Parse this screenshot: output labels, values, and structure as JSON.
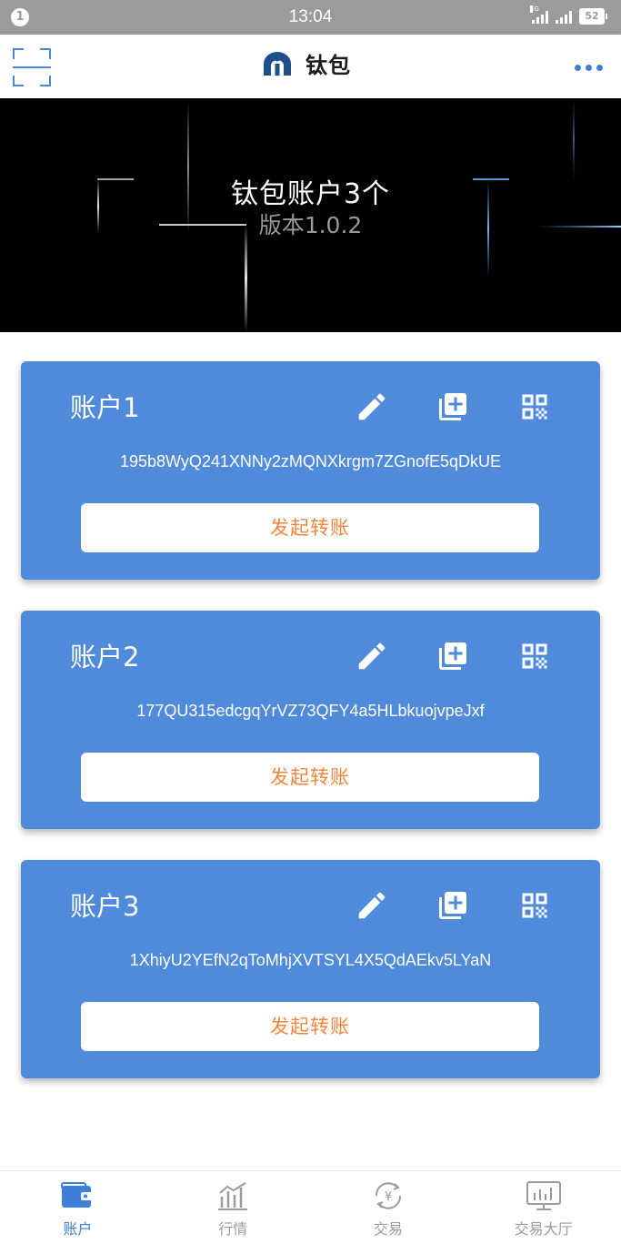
{
  "status_bar": {
    "notification_count": "1",
    "time": "13:04",
    "network_type": "4G",
    "battery": "52"
  },
  "app_bar": {
    "title": "钛包",
    "scan_icon": "scan-icon",
    "logo_icon": "titanium-wallet-logo",
    "more_icon": "more-dots-icon"
  },
  "banner": {
    "title": "钛包账户3个",
    "version": "版本1.0.2"
  },
  "accounts": [
    {
      "name": "账户1",
      "address": "195b8WyQ241XNNy2zMQNXkrgm7ZGnofE5qDkUE",
      "transfer_label": "发起转账"
    },
    {
      "name": "账户2",
      "address": "177QU315edcgqYrVZ73QFY4a5HLbkuojvpeJxf",
      "transfer_label": "发起转账"
    },
    {
      "name": "账户3",
      "address": "1XhiyU2YEfN2qToMhjXVTSYL4X5QdAEkv5LYaN",
      "transfer_label": "发起转账"
    }
  ],
  "card_icons": {
    "edit": "pencil-icon",
    "copy": "copy-add-icon",
    "qr": "qr-code-icon"
  },
  "bottom_nav": [
    {
      "label": "账户",
      "icon": "wallet-icon",
      "active": true
    },
    {
      "label": "行情",
      "icon": "chart-icon",
      "active": false
    },
    {
      "label": "交易",
      "icon": "yen-exchange-icon",
      "active": false
    },
    {
      "label": "交易大厅",
      "icon": "monitor-chart-icon",
      "active": false
    }
  ],
  "colors": {
    "primary": "#508bdb",
    "accent_orange": "#f5863e",
    "status_bar": "#9b9b9b",
    "nav_active": "#3d7fd9",
    "nav_inactive": "#9b9b9b"
  }
}
